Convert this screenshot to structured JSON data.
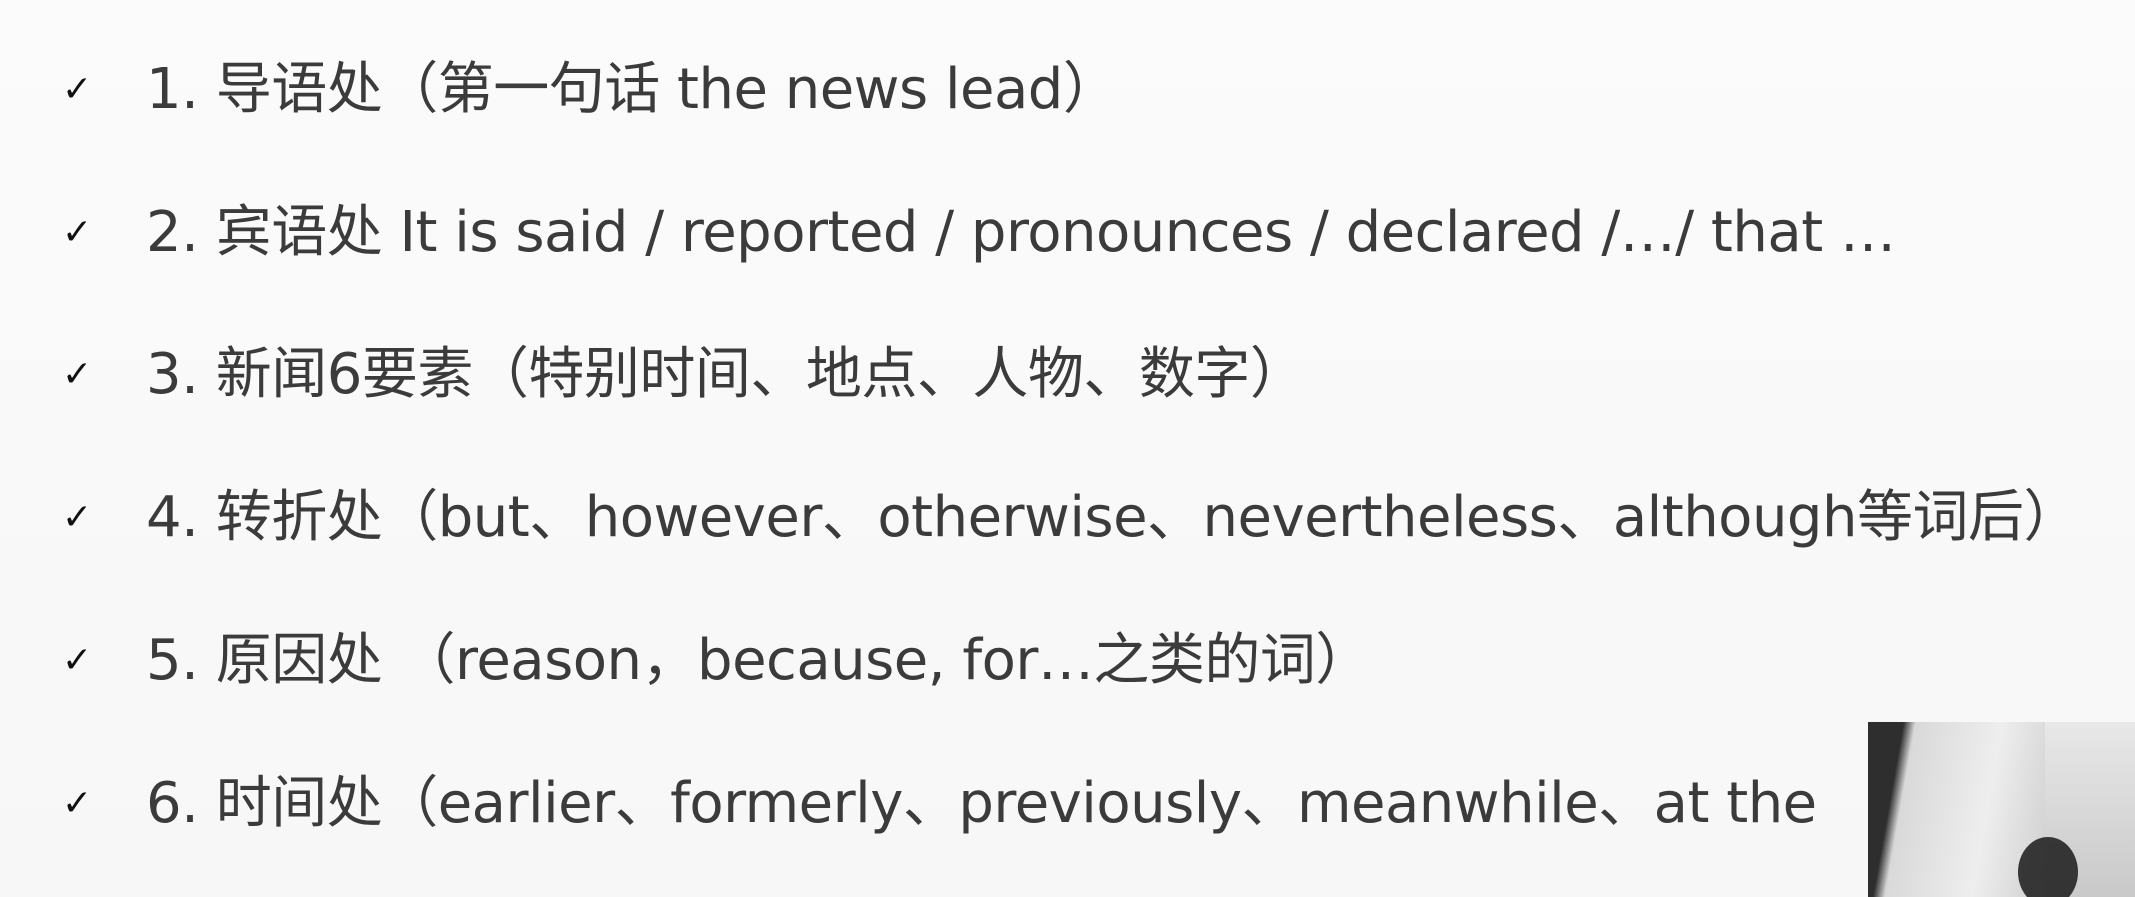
{
  "slide": {
    "check_mark": "✓",
    "items": [
      {
        "text": "1. 导语处（第一句话 the news lead）"
      },
      {
        "text": "2. 宾语处 It is said / reported / pronounces / declared /…/ that …"
      },
      {
        "text": "3. 新闻6要素（特别时间、地点、人物、数字）"
      },
      {
        "text": "4. 转折处（but、however、otherwise、nevertheless、although等词后）"
      },
      {
        "text": "5. 原因处 （reason，because, for…之类的词）"
      },
      {
        "text": "6. 时间处（earlier、formerly、previously、meanwhile、at the"
      }
    ]
  },
  "colors": {
    "background": "#fafafa",
    "text": "#3b3b3b",
    "check": "#111111"
  }
}
